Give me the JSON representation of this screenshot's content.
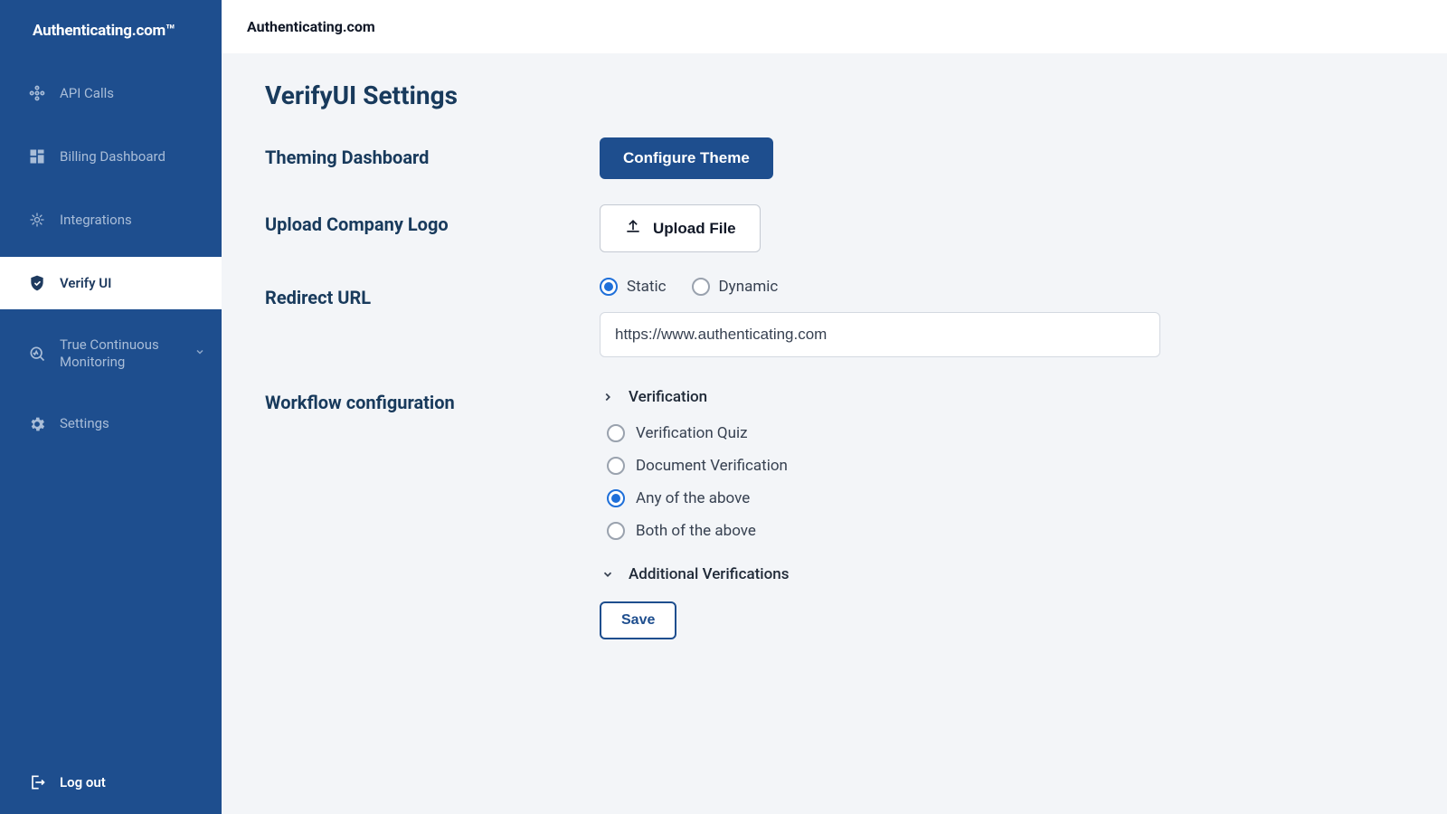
{
  "brand": "Authenticating.com™",
  "topbar": {
    "title": "Authenticating.com"
  },
  "sidebar": {
    "items": [
      {
        "id": "api-calls",
        "label": "API Calls",
        "icon": "api",
        "active": false,
        "expandable": false
      },
      {
        "id": "billing",
        "label": "Billing Dashboard",
        "icon": "billing",
        "active": false,
        "expandable": false
      },
      {
        "id": "integrations",
        "label": "Integrations",
        "icon": "integrations",
        "active": false,
        "expandable": false
      },
      {
        "id": "verify-ui",
        "label": "Verify UI",
        "icon": "shield",
        "active": true,
        "expandable": false
      },
      {
        "id": "tcm",
        "label": "True Continuous Monitoring",
        "icon": "monitor",
        "active": false,
        "expandable": true
      },
      {
        "id": "settings",
        "label": "Settings",
        "icon": "gear",
        "active": false,
        "expandable": false
      }
    ],
    "logout": "Log out"
  },
  "page": {
    "title": "VerifyUI Settings",
    "theming": {
      "label": "Theming Dashboard",
      "button": "Configure Theme"
    },
    "upload": {
      "label": "Upload Company Logo",
      "button": "Upload File"
    },
    "redirect": {
      "label": "Redirect URL",
      "options": {
        "static": {
          "label": "Static",
          "selected": true
        },
        "dynamic": {
          "label": "Dynamic",
          "selected": false
        }
      },
      "value": "https://www.authenticating.com"
    },
    "workflow": {
      "label": "Workflow configuration",
      "verification": {
        "label": "Verification",
        "expanded": true,
        "options": [
          {
            "id": "quiz",
            "label": "Verification Quiz",
            "selected": false
          },
          {
            "id": "doc",
            "label": "Document Verification",
            "selected": false
          },
          {
            "id": "any",
            "label": "Any of the above",
            "selected": true
          },
          {
            "id": "both",
            "label": "Both of the above",
            "selected": false
          }
        ]
      },
      "additional": {
        "label": "Additional Verifications",
        "expanded": false
      },
      "save": "Save"
    }
  }
}
